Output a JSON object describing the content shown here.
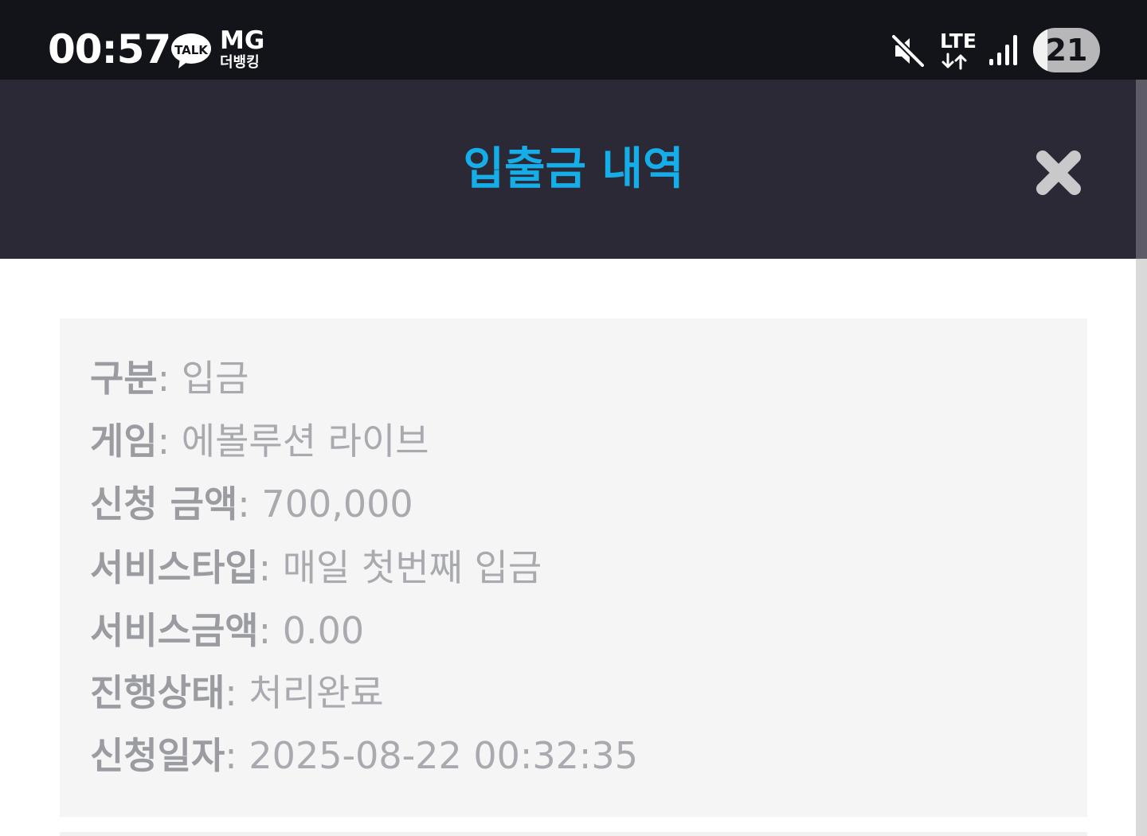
{
  "status_bar": {
    "time": "00:57",
    "talk_badge": "TALK",
    "carrier_top": "MG",
    "carrier_bottom": "더뱅킹",
    "network": "LTE",
    "battery_level": "21",
    "battery_fraction": 0.21,
    "icons": [
      "kakaotalk-icon",
      "mute-icon",
      "lte-data-icon",
      "signal-icon",
      "battery-icon"
    ]
  },
  "header": {
    "title": "입출금 내역",
    "title_color": "#16aee9",
    "background": "#2a2935",
    "close_icon": "close-x-icon"
  },
  "details": [
    {
      "label": "구분",
      "value": "입금"
    },
    {
      "label": "게임",
      "value": "에볼루션 라이브"
    },
    {
      "label": "신청 금액",
      "value": "700,000"
    },
    {
      "label": "서비스타입",
      "value": "매일 첫번째 입금"
    },
    {
      "label": "서비스금액",
      "value": "0.00"
    },
    {
      "label": "진행상태",
      "value": "처리완료"
    },
    {
      "label": "신청일자",
      "value": "2025-08-22 00:32:35"
    }
  ],
  "separator": ": "
}
